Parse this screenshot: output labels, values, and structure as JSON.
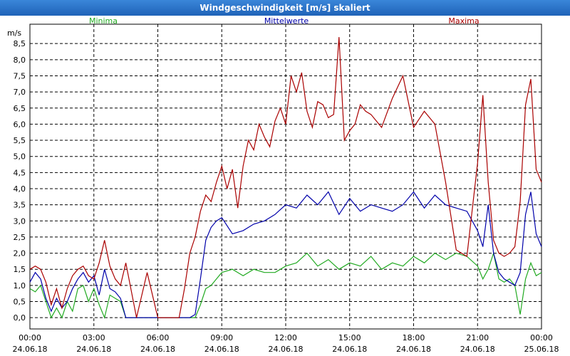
{
  "window": {
    "title": "Windgeschwindigkeit [m/s] skaliert"
  },
  "chart_data": {
    "type": "line",
    "title": "Windgeschwindigkeit [m/s] skaliert",
    "ylabel": "m/s",
    "ylim": [
      -0.35,
      9.1
    ],
    "xlim_hours": [
      0,
      24
    ],
    "y_ticks": [
      "0,0",
      "0,5",
      "1,0",
      "1,5",
      "2,0",
      "2,5",
      "3,0",
      "3,5",
      "4,0",
      "4,5",
      "5,0",
      "5,5",
      "6,0",
      "6,5",
      "7,0",
      "7,5",
      "8,0",
      "8,5"
    ],
    "x_ticks": [
      {
        "time": "00:00",
        "date": "24.06.18"
      },
      {
        "time": "03:00",
        "date": "24.06.18"
      },
      {
        "time": "06:00",
        "date": "24.06.18"
      },
      {
        "time": "09:00",
        "date": "24.06.18"
      },
      {
        "time": "12:00",
        "date": "24.06.18"
      },
      {
        "time": "15:00",
        "date": "24.06.18"
      },
      {
        "time": "18:00",
        "date": "24.06.18"
      },
      {
        "time": "21:00",
        "date": "24.06.18"
      },
      {
        "time": "00:00",
        "date": "25.06.18"
      }
    ],
    "grid": true,
    "legend_placement": "top",
    "series": [
      {
        "name": "Minima",
        "color": "#22aa22",
        "x": [
          0,
          0.25,
          0.5,
          0.75,
          1.0,
          1.25,
          1.5,
          1.75,
          2.0,
          2.25,
          2.5,
          2.75,
          3.0,
          3.25,
          3.5,
          3.75,
          4.0,
          4.25,
          4.5,
          5.0,
          5.5,
          6.0,
          6.5,
          7.0,
          7.5,
          7.75,
          8.0,
          8.25,
          8.5,
          8.75,
          9.0,
          9.5,
          10.0,
          10.5,
          11.0,
          11.5,
          12.0,
          12.5,
          13.0,
          13.5,
          14.0,
          14.5,
          15.0,
          15.5,
          16.0,
          16.5,
          17.0,
          17.5,
          18.0,
          18.5,
          19.0,
          19.5,
          20.0,
          20.5,
          21.0,
          21.25,
          21.5,
          21.75,
          22.0,
          22.25,
          22.5,
          22.75,
          23.0,
          23.25,
          23.5,
          23.75,
          24.0
        ],
        "y": [
          0.9,
          0.8,
          1.0,
          0.5,
          0.0,
          0.3,
          0.0,
          0.5,
          0.2,
          0.9,
          1.0,
          0.5,
          0.9,
          0.4,
          0.0,
          0.7,
          0.6,
          0.5,
          0.0,
          0.0,
          0.0,
          0.0,
          0.0,
          0.0,
          0.0,
          0.0,
          0.4,
          0.9,
          1.0,
          1.2,
          1.4,
          1.5,
          1.3,
          1.5,
          1.4,
          1.4,
          1.6,
          1.7,
          2.0,
          1.6,
          1.8,
          1.5,
          1.7,
          1.6,
          1.9,
          1.5,
          1.7,
          1.6,
          1.9,
          1.7,
          2.0,
          1.8,
          2.0,
          1.9,
          1.6,
          1.2,
          1.5,
          2.0,
          1.2,
          1.1,
          1.2,
          1.0,
          0.1,
          1.2,
          1.7,
          1.3,
          1.4
        ]
      },
      {
        "name": "Mittelwerte",
        "color": "#0000aa",
        "x": [
          0,
          0.25,
          0.5,
          0.75,
          1.0,
          1.25,
          1.5,
          1.75,
          2.0,
          2.25,
          2.5,
          2.75,
          3.0,
          3.25,
          3.5,
          3.75,
          4.0,
          4.25,
          4.5,
          5.0,
          5.5,
          6.0,
          6.5,
          7.0,
          7.5,
          7.75,
          8.0,
          8.25,
          8.5,
          8.75,
          9.0,
          9.5,
          10.0,
          10.5,
          11.0,
          11.5,
          12.0,
          12.5,
          13.0,
          13.5,
          14.0,
          14.5,
          15.0,
          15.5,
          16.0,
          16.5,
          17.0,
          17.5,
          18.0,
          18.5,
          19.0,
          19.5,
          20.0,
          20.5,
          21.0,
          21.25,
          21.5,
          21.75,
          22.0,
          22.25,
          22.5,
          22.75,
          23.0,
          23.25,
          23.5,
          23.75,
          24.0
        ],
        "y": [
          1.1,
          1.4,
          1.2,
          0.6,
          0.2,
          0.6,
          0.3,
          0.5,
          0.9,
          1.2,
          1.4,
          1.1,
          1.3,
          0.7,
          1.5,
          0.9,
          0.8,
          0.6,
          0.0,
          0.0,
          0.0,
          0.0,
          0.0,
          0.0,
          0.0,
          0.1,
          1.2,
          2.4,
          2.8,
          3.0,
          3.1,
          2.6,
          2.7,
          2.9,
          3.0,
          3.2,
          3.5,
          3.4,
          3.8,
          3.5,
          3.9,
          3.2,
          3.7,
          3.3,
          3.5,
          3.4,
          3.3,
          3.5,
          3.9,
          3.4,
          3.8,
          3.5,
          3.4,
          3.3,
          2.7,
          2.2,
          3.5,
          2.0,
          1.4,
          1.2,
          1.1,
          1.0,
          1.4,
          3.2,
          3.9,
          2.6,
          2.2
        ]
      },
      {
        "name": "Maxima",
        "color": "#aa0000",
        "x": [
          0,
          0.25,
          0.5,
          0.75,
          1.0,
          1.25,
          1.5,
          1.75,
          2.0,
          2.25,
          2.5,
          2.75,
          3.0,
          3.25,
          3.5,
          3.75,
          4.0,
          4.25,
          4.5,
          5.0,
          5.5,
          6.0,
          6.5,
          7.0,
          7.25,
          7.5,
          7.75,
          8.0,
          8.25,
          8.5,
          8.75,
          9.0,
          9.25,
          9.5,
          9.75,
          10.0,
          10.25,
          10.5,
          10.75,
          11.0,
          11.25,
          11.5,
          11.75,
          12.0,
          12.25,
          12.5,
          12.75,
          13.0,
          13.25,
          13.5,
          13.75,
          14.0,
          14.25,
          14.5,
          14.75,
          15.0,
          15.25,
          15.5,
          15.75,
          16.0,
          16.5,
          17.0,
          17.5,
          18.0,
          18.5,
          19.0,
          19.5,
          20.0,
          20.5,
          21.0,
          21.25,
          21.5,
          21.75,
          22.0,
          22.25,
          22.5,
          22.75,
          23.0,
          23.25,
          23.5,
          23.75,
          24.0
        ],
        "y": [
          1.5,
          1.6,
          1.5,
          1.1,
          0.4,
          0.9,
          0.3,
          0.9,
          1.3,
          1.5,
          1.6,
          1.3,
          1.2,
          1.7,
          2.4,
          1.6,
          1.2,
          1.0,
          1.7,
          0.0,
          1.4,
          0.0,
          0.0,
          0.0,
          0.9,
          2.0,
          2.5,
          3.3,
          3.8,
          3.6,
          4.2,
          4.7,
          4.0,
          4.6,
          3.4,
          4.7,
          5.5,
          5.2,
          6.0,
          5.6,
          5.3,
          6.1,
          6.5,
          6.0,
          7.5,
          7.0,
          7.6,
          6.4,
          5.9,
          6.7,
          6.6,
          6.2,
          6.3,
          8.7,
          5.5,
          5.8,
          6.0,
          6.6,
          6.4,
          6.3,
          5.9,
          6.8,
          7.5,
          5.9,
          6.4,
          6.0,
          4.2,
          2.1,
          1.9,
          4.8,
          6.9,
          4.2,
          2.4,
          2.0,
          1.9,
          2.0,
          2.2,
          3.6,
          6.6,
          7.4,
          4.6,
          4.2
        ]
      }
    ]
  }
}
